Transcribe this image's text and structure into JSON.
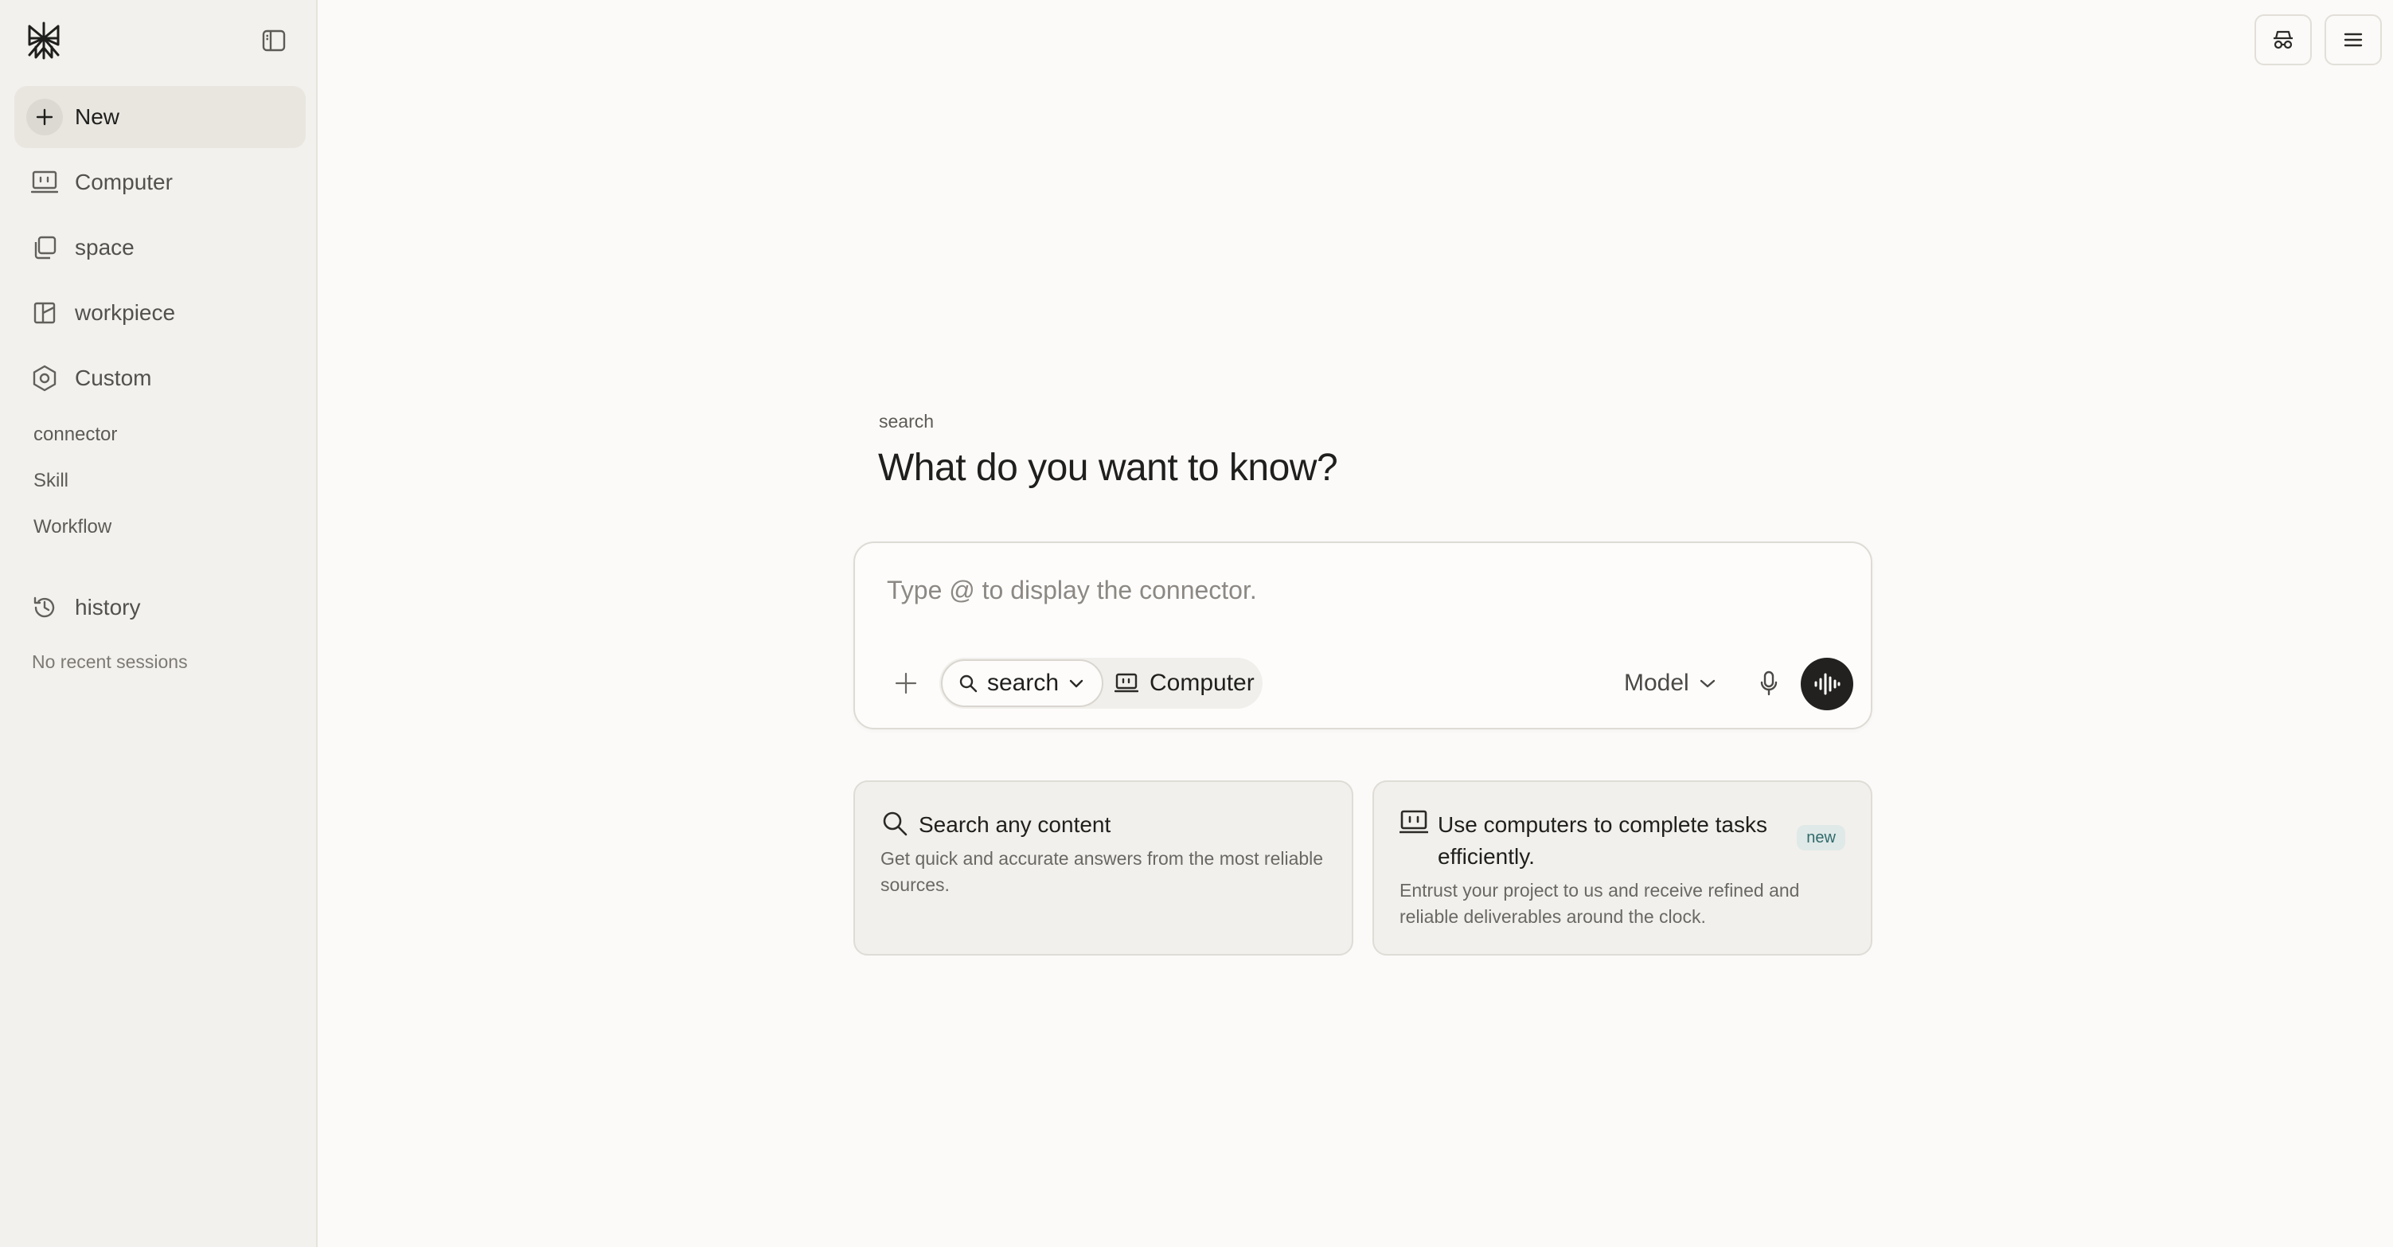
{
  "sidebar": {
    "new_label": "New",
    "items": [
      {
        "label": "Computer",
        "icon": "computer-icon"
      },
      {
        "label": "space",
        "icon": "stack-icon"
      },
      {
        "label": "workpiece",
        "icon": "workpiece-icon"
      },
      {
        "label": "Custom",
        "icon": "hexagon-icon"
      }
    ],
    "sub_items": [
      "connector",
      "Skill",
      "Workflow"
    ],
    "history_label": "history",
    "history_empty": "No recent sessions"
  },
  "main": {
    "eyebrow": "search",
    "title": "What do you want to know?",
    "composer": {
      "placeholder": "Type @ to display the connector.",
      "value": "",
      "mode_search_label": "search",
      "mode_computer_label": "Computer",
      "model_label": "Model"
    },
    "cards": [
      {
        "icon": "search-icon",
        "title": "Search any content",
        "description": "Get quick and accurate answers from the most reliable sources."
      },
      {
        "icon": "computer-icon",
        "title": "Use computers to complete tasks efficiently.",
        "badge": "new",
        "description": "Entrust your project to us and receive refined and reliable deliverables around the clock."
      }
    ]
  },
  "colors": {
    "background": "#fbfaf8",
    "sidebar": "#f3f1ed",
    "text": "#1f1f1d",
    "badge_bg": "#dfe9e8",
    "badge_text": "#2f6b6a",
    "voice_button": "#22211f"
  }
}
